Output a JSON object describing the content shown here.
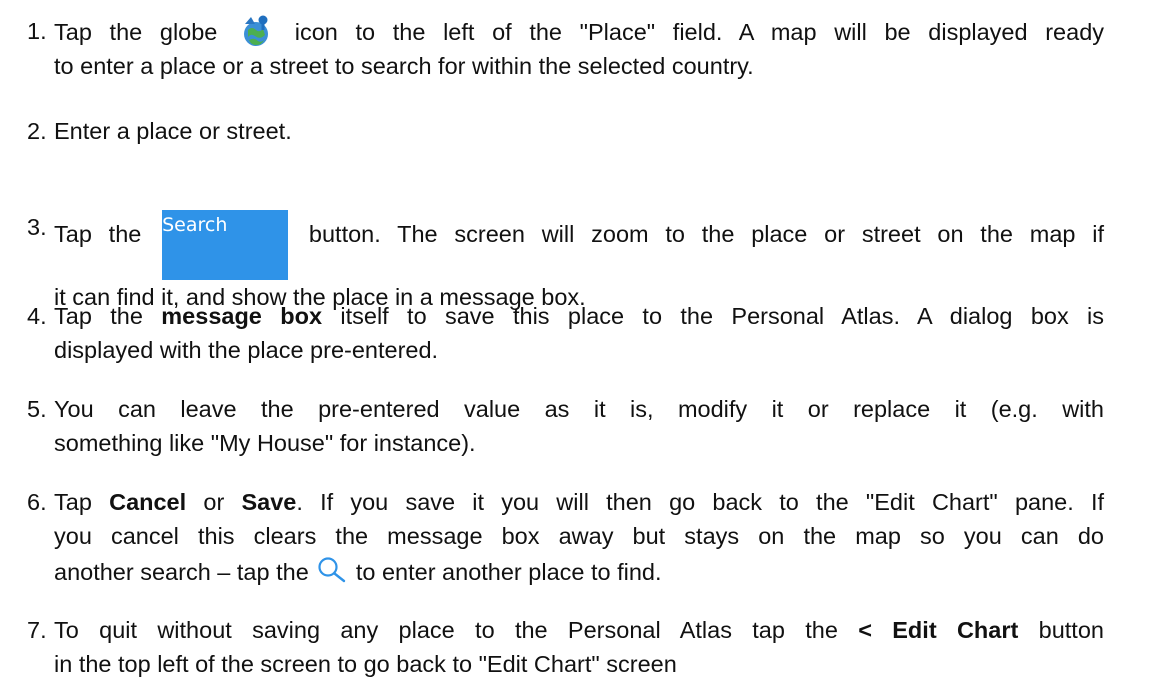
{
  "steps": [
    {
      "number": "1.",
      "line1_a": "Tap the globe",
      "line1_b": "icon to the left of the \"Place\" field. A map will be displayed ready",
      "line2": "to enter a place or a street to search for within the selected country.",
      "icon": "globe-map-icon"
    },
    {
      "number": "2.",
      "line1": "Enter a place or street."
    },
    {
      "number": "3.",
      "line1_a": "Tap the",
      "button_label": "Search",
      "line1_b": "button. The screen will zoom to the place or street on the map if",
      "line2": "it can find it, and show the place in a message box.",
      "button_color": "#2f93e8"
    },
    {
      "number": "4.",
      "line1_a": "Tap the",
      "bold": "message box",
      "line1_b": "itself to save this place to the Personal Atlas. A dialog box is",
      "line2": "displayed with the place pre-entered."
    },
    {
      "number": "5.",
      "line1": "You can leave the pre-entered value as it is, modify it or replace it (e.g. with",
      "line2": "something like \"My House\" for instance)."
    },
    {
      "number": "6.",
      "line1_a": "Tap",
      "bold1": "Cancel",
      "line1_or": "or",
      "bold2": "Save",
      "line1_b": ". If you save it you will then go back to the \"Edit Chart\" pane. If",
      "line2": "you cancel this clears the message box away but stays on the map so you can do",
      "line3_a": "another search – tap the",
      "line3_b": "to enter another place to find.",
      "icon": "magnifier-icon"
    },
    {
      "number": "7.",
      "line1_a": "To quit without saving any place to the Personal Atlas tap the",
      "bold": "< Edit Chart",
      "line1_b": "button",
      "line2": "in the top left of the screen to go back to \"Edit Chart\" screen"
    }
  ]
}
